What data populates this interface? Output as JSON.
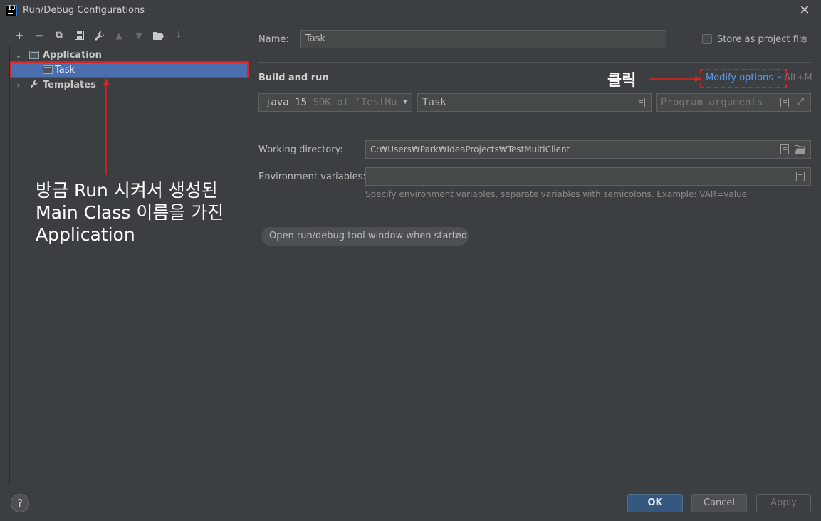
{
  "window": {
    "title": "Run/Debug Configurations",
    "logo_text": "IJ",
    "close_label": "✕"
  },
  "toolbar": {
    "add": "+",
    "remove": "−",
    "copy": "⧉",
    "save": "💾",
    "edit": "🔧",
    "up": "▲",
    "down": "▼",
    "folder": "📁",
    "sort": "↓"
  },
  "tree": {
    "application_label": "Application",
    "task_label": "Task",
    "templates_label": "Templates"
  },
  "annotation": {
    "left_text": "방금 Run 시켜서 생성된 Main Class 이름을 가진 Application",
    "click_text": "클릭"
  },
  "form": {
    "name_label": "Name:",
    "name_value": "Task",
    "store_label": "Store as project file",
    "section_title": "Build and run",
    "modify_options": "Modify options",
    "modify_chevron": "⌄",
    "shortcut": "Alt+M",
    "jdk_bold": "java 15",
    "jdk_rest": " SDK of 'TestMu",
    "main_class": "Task",
    "program_args_placeholder": "Program arguments",
    "workdir_label": "Working directory:",
    "workdir_value": "C:₩Users₩Park₩IdeaProjects₩TestMultiClient",
    "env_label": "Environment variables:",
    "env_value": "",
    "env_hint": "Specify environment variables, separate variables with semicolons. Example: VAR=value",
    "chip_label": "Open run/debug tool window when started",
    "chip_close": "✕"
  },
  "buttons": {
    "help": "?",
    "ok": "OK",
    "cancel": "Cancel",
    "apply": "Apply"
  },
  "colors": {
    "background": "#3c3f41",
    "selection": "#4b6eaf",
    "link": "#589df6",
    "annotation_red": "#e0201e",
    "ok_button": "#365880"
  }
}
